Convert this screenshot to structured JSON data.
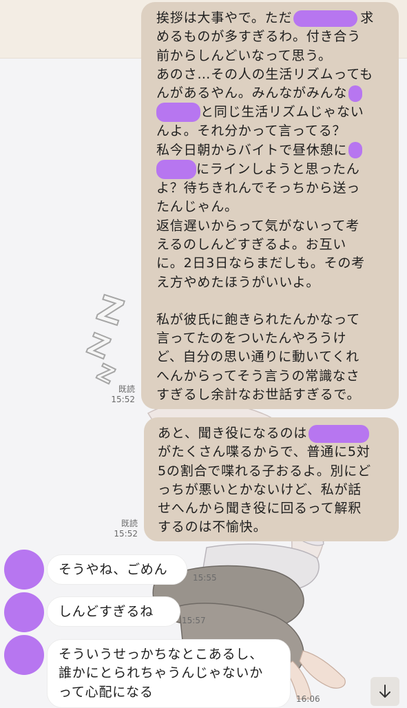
{
  "colors": {
    "sent_bubble": "#ddd0c1",
    "received_bubble": "#ffffff",
    "redaction": "#b776f0",
    "background": "#f4f4f6"
  },
  "decoration": {
    "zzz": [
      "Z",
      "Z",
      "Z"
    ]
  },
  "messages": [
    {
      "type": "sent",
      "read_label": "既読",
      "time": "15:52",
      "lines": [
        {
          "before": "挨拶は大事やで。ただ",
          "after": "求"
        },
        {
          "text": "めるものが多すぎるわ。付き合う"
        },
        {
          "text": "前からしんどいなって思う。"
        },
        {
          "text": "あのさ…その人の生活リズムっても"
        },
        {
          "text": "んがあるやん。みんながみんな"
        },
        {
          "before": "",
          "after": "と同じ生活リズムじゃない"
        },
        {
          "text": "んよ。それ分かって言ってる？"
        },
        {
          "text": "私今日朝からバイトで昼休憩に"
        },
        {
          "before": "",
          "after": "にラインしようと思ったん"
        },
        {
          "text": "よ？待ちきれんでそっちから送っ"
        },
        {
          "text": "たんじゃん。"
        },
        {
          "text": "返信遅いからって気がないって考"
        },
        {
          "text": "えるのしんどすぎるよ。お互い"
        },
        {
          "text": "に。2日3日ならまだしも。その考"
        },
        {
          "text": "え方やめたほうがいいよ。"
        },
        {
          "text": ""
        },
        {
          "text": "私が彼氏に飽きられたんかなって"
        },
        {
          "text": "言ってたのをついたんやろうけ"
        },
        {
          "text": "ど、自分の思い通りに動いてくれ"
        },
        {
          "text": "へんからってそう言うの常識なさ"
        },
        {
          "text": "すぎるし余計なお世話すぎるで。"
        }
      ]
    },
    {
      "type": "sent",
      "read_label": "既読",
      "time": "15:52",
      "lines": [
        {
          "before": "あと、聞き役になるのは",
          "after": ""
        },
        {
          "text": "がたくさん喋るからで、普通に5対"
        },
        {
          "text": "5の割合で喋れる子おるよ。別にど"
        },
        {
          "text": "っちが悪いとかないけど、私が話"
        },
        {
          "text": "せへんから聞き役に回るって解釈"
        },
        {
          "text": "するのは不愉快。"
        }
      ]
    },
    {
      "type": "received",
      "time": "15:55",
      "lines": [
        {
          "text": "そうやね、ごめん"
        }
      ]
    },
    {
      "type": "received",
      "time": "15:57",
      "lines": [
        {
          "text": "しんどすぎるね"
        }
      ]
    },
    {
      "type": "received",
      "time": "16:06",
      "lines": [
        {
          "text": "そういうせっかちなとこあるし、"
        },
        {
          "text": "誰かにとられちゃうんじゃないか"
        },
        {
          "text": "って心配になる"
        }
      ]
    }
  ],
  "scroll_button": {
    "icon": "arrow-down-icon"
  }
}
